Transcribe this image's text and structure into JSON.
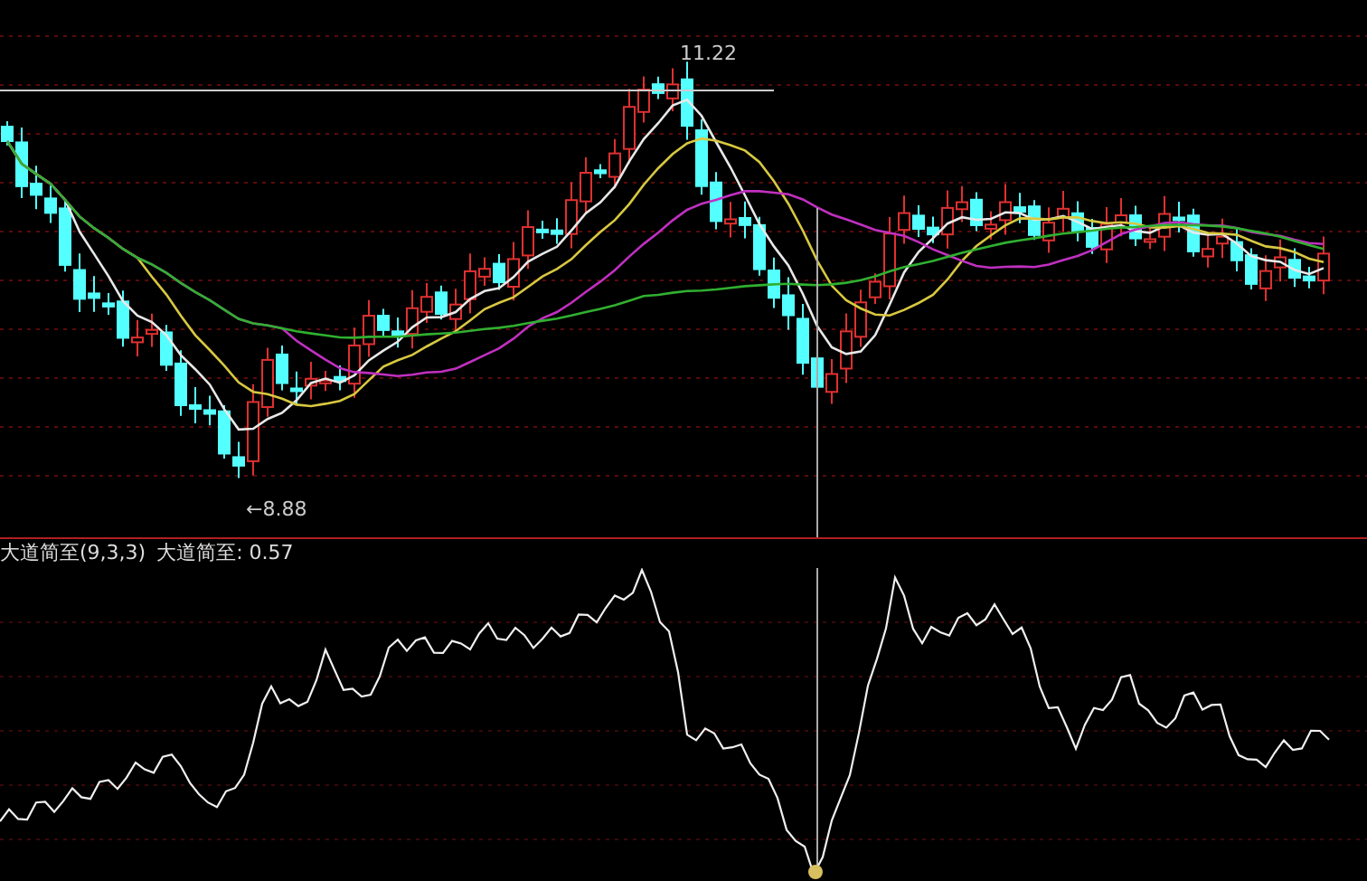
{
  "main_chart": {
    "high_label": "11.22",
    "low_label": "←8.88"
  },
  "indicator": {
    "name": "大道简至(9,3,3)",
    "reading": "大道简至: 0.57"
  }
}
